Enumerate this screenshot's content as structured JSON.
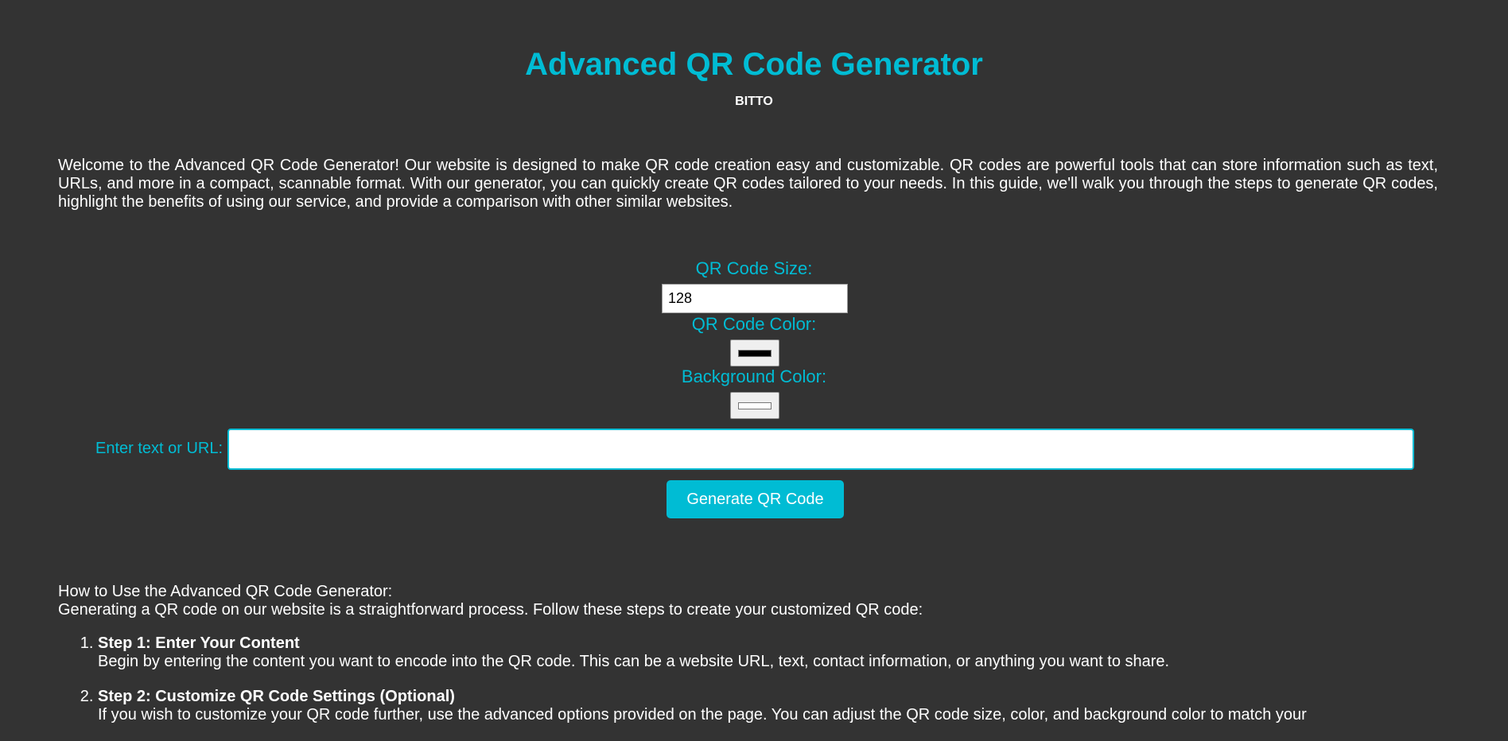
{
  "header": {
    "title": "Advanced QR Code Generator",
    "author": "BITTO"
  },
  "intro": {
    "text": "Welcome to the Advanced QR Code Generator! Our website is designed to make QR code creation easy and customizable. QR codes are powerful tools that can store information such as text, URLs, and more in a compact, scannable format. With our generator, you can quickly create QR codes tailored to your needs. In this guide, we'll walk you through the steps to generate QR codes, highlight the benefits of using our service, and provide a comparison with other similar websites."
  },
  "form": {
    "size_label": "QR Code Size:",
    "size_value": "128",
    "color_label": "QR Code Color:",
    "color_value": "#000000",
    "bg_label": "Background Color:",
    "bg_value": "#ffffff",
    "text_label": "Enter text or URL:",
    "text_value": "",
    "generate_label": "Generate QR Code"
  },
  "howto": {
    "heading": "How to Use the Advanced QR Code Generator:",
    "intro": "Generating a QR code on our website is a straightforward process. Follow these steps to create your customized QR code:",
    "steps": [
      {
        "title": "Step 1: Enter Your Content",
        "desc": "Begin by entering the content you want to encode into the QR code. This can be a website URL, text, contact information, or anything you want to share."
      },
      {
        "title": "Step 2: Customize QR Code Settings (Optional)",
        "desc": "If you wish to customize your QR code further, use the advanced options provided on the page. You can adjust the QR code size, color, and background color to match your"
      }
    ]
  },
  "colors": {
    "accent": "#00bcd4",
    "background": "#333333",
    "text": "#ffffff"
  }
}
